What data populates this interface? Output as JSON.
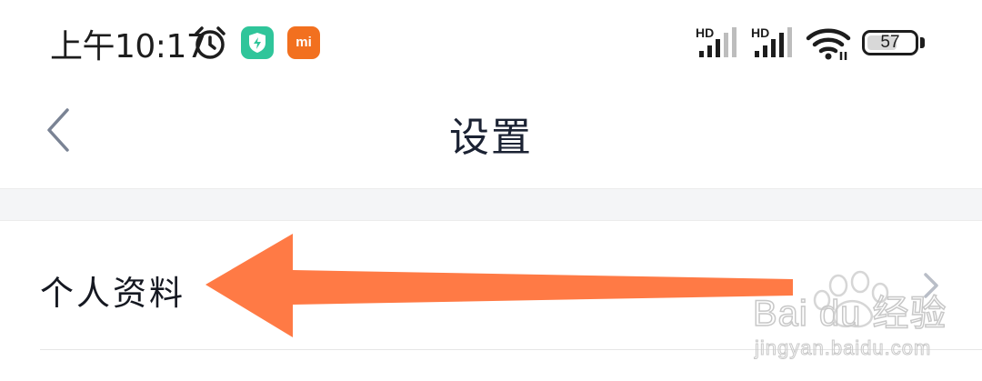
{
  "status_bar": {
    "time": "上午10:17",
    "app_icons": [
      "alarm-icon",
      "security-shield-app-icon",
      "mi-app-icon"
    ],
    "mi_label": "mi",
    "signal_badges": [
      "HD",
      "HD"
    ],
    "battery": "57"
  },
  "nav": {
    "back_icon": "chevron-left-icon",
    "title": "设置"
  },
  "list": {
    "items": [
      {
        "label": "个人资料",
        "icon": "chevron-right-icon"
      }
    ]
  },
  "annotation": {
    "type": "arrow",
    "color": "#ff7a45"
  },
  "watermark": {
    "brand": "Bai du 经验",
    "url": "jingyan.baidu.com"
  },
  "colors": {
    "background": "#ffffff",
    "divider_band": "#f4f5f7",
    "title_text": "#1b2233",
    "security_app": "#2fc59a",
    "mi_app": "#f2701f"
  }
}
